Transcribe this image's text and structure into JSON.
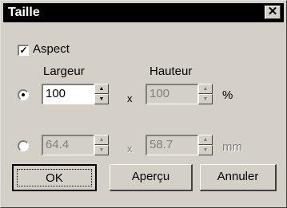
{
  "window": {
    "title": "Taille",
    "close_symbol": "✕"
  },
  "aspect": {
    "label": "Aspect",
    "checked": true,
    "check_mark": "✓"
  },
  "headers": {
    "width": "Largeur",
    "height": "Hauteur"
  },
  "row_percent": {
    "selected": true,
    "width_value": "100",
    "height_value": "100",
    "separator": "x",
    "unit": "%"
  },
  "row_mm": {
    "selected": false,
    "width_value": "64.4",
    "height_value": "58.7",
    "separator": "x",
    "unit": "mm"
  },
  "spinner": {
    "up_glyph": "▲",
    "down_glyph": "▼"
  },
  "buttons": {
    "ok": "OK",
    "preview": "Aperçu",
    "cancel": "Annuler"
  }
}
